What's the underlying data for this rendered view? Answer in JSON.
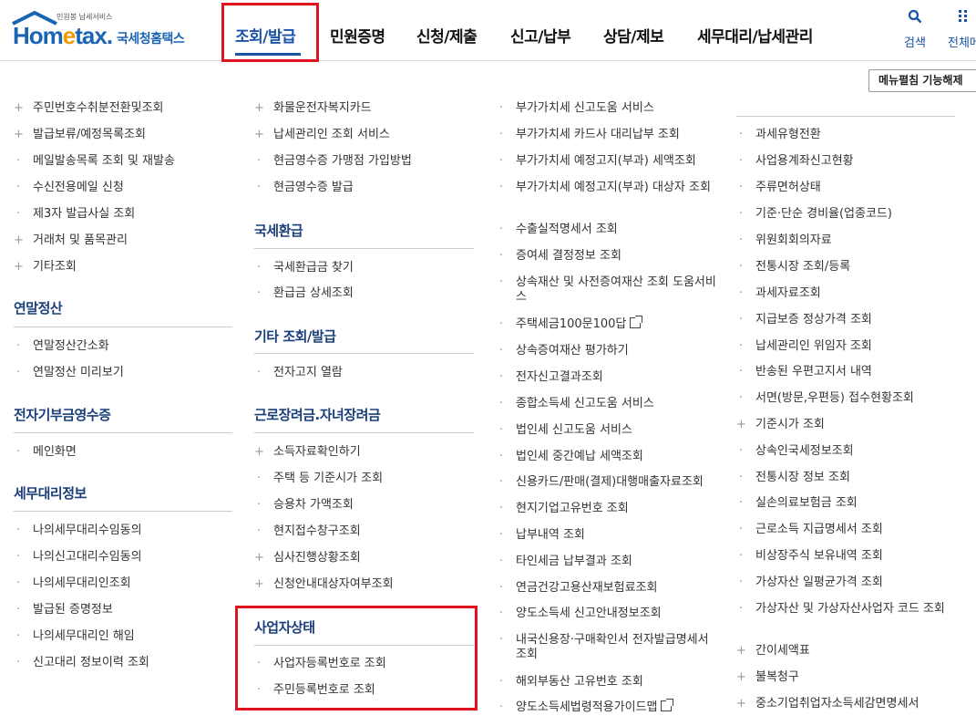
{
  "header": {
    "logo_sub": "민원봉 납세서비스",
    "logo_text_a": "Hom",
    "logo_text_b": "e",
    "logo_text_c": "tax.",
    "logo_kr": "국세청홈택스",
    "nav": [
      "조회/발급",
      "민원증명",
      "신청/제출",
      "신고/납부",
      "상담/제보",
      "세무대리/납세관리"
    ],
    "search_label": "검색",
    "menu_label": "전체메"
  },
  "fold_button": "메뉴펼침 기능해제",
  "col1": {
    "items_a": [
      {
        "m": "+",
        "t": "주민번호수취분전환및조회"
      },
      {
        "m": "+",
        "t": "발급보류/예정목록조회"
      },
      {
        "m": "·",
        "t": "메일발송목록 조회 및 재발송"
      },
      {
        "m": "·",
        "t": "수신전용메일 신청"
      },
      {
        "m": "·",
        "t": "제3자 발급사실 조회"
      },
      {
        "m": "+",
        "t": "거래처 및 품목관리"
      },
      {
        "m": "+",
        "t": "기타조회"
      }
    ],
    "sec1": "연말정산",
    "items_b": [
      {
        "m": "·",
        "t": "연말정산간소화"
      },
      {
        "m": "·",
        "t": "연말정산 미리보기"
      }
    ],
    "sec2": "전자기부금영수증",
    "items_c": [
      {
        "m": "·",
        "t": "메인화면"
      }
    ],
    "sec3": "세무대리정보",
    "items_d": [
      {
        "m": "·",
        "t": "나의세무대리수임동의"
      },
      {
        "m": "·",
        "t": "나의신고대리수임동의"
      },
      {
        "m": "·",
        "t": "나의세무대리인조회"
      },
      {
        "m": "·",
        "t": "발급된 증명정보"
      },
      {
        "m": "·",
        "t": "나의세무대리인 해임"
      },
      {
        "m": "·",
        "t": "신고대리 정보이력 조회"
      }
    ]
  },
  "col2": {
    "items_a": [
      {
        "m": "+",
        "t": "화물운전자복지카드"
      },
      {
        "m": "+",
        "t": "납세관리인 조회 서비스"
      },
      {
        "m": "·",
        "t": "현금영수증 가맹점 가입방법"
      },
      {
        "m": "·",
        "t": "현금영수증 발급"
      }
    ],
    "sec1": "국세환급",
    "items_b": [
      {
        "m": "·",
        "t": "국세환급금 찾기"
      },
      {
        "m": "·",
        "t": "환급금 상세조회"
      }
    ],
    "sec2": "기타 조회/발급",
    "items_c": [
      {
        "m": "·",
        "t": "전자고지 열람"
      }
    ],
    "sec3": "근로장려금.자녀장려금",
    "items_d": [
      {
        "m": "+",
        "t": "소득자료확인하기"
      },
      {
        "m": "·",
        "t": "주택 등 기준시가 조회"
      },
      {
        "m": "·",
        "t": "승용차 가액조회"
      },
      {
        "m": "·",
        "t": "현지접수창구조회"
      },
      {
        "m": "+",
        "t": "심사진행상황조회"
      },
      {
        "m": "+",
        "t": "신청안내대상자여부조회"
      }
    ],
    "sec4": "사업자상태",
    "items_e": [
      {
        "m": "·",
        "t": "사업자등록번호로 조회"
      },
      {
        "m": "·",
        "t": "주민등록번호로 조회"
      }
    ]
  },
  "col3": {
    "items": [
      {
        "m": "·",
        "t": "부가가치세 신고도움 서비스"
      },
      {
        "m": "·",
        "t": "부가가치세 카드사 대리납부 조회"
      },
      {
        "m": "·",
        "t": "부가가치세 예정고지(부과) 세액조회"
      },
      {
        "m": "·",
        "t": "부가가치세 예정고지(부과) 대상자 조회"
      },
      {
        "m": "·",
        "t": "수출실적명세서 조회"
      },
      {
        "m": "·",
        "t": "증여세 결정정보 조회"
      },
      {
        "m": "·",
        "t": "상속재산 및 사전증여재산 조회 도움서비스"
      },
      {
        "m": "·",
        "t": "주택세금100문100답"
      },
      {
        "m": "·",
        "t": "상속증여재산 평가하기"
      },
      {
        "m": "·",
        "t": "전자신고결과조회"
      },
      {
        "m": "·",
        "t": "종합소득세 신고도움 서비스"
      },
      {
        "m": "·",
        "t": "법인세 신고도움 서비스"
      },
      {
        "m": "·",
        "t": "법인세 중간예납 세액조회"
      },
      {
        "m": "·",
        "t": "신용카드/판매(결제)대행매출자료조회"
      },
      {
        "m": "·",
        "t": "현지기업고유번호 조회"
      },
      {
        "m": "·",
        "t": "납부내역 조회"
      },
      {
        "m": "·",
        "t": "타인세금 납부결과 조회"
      },
      {
        "m": "·",
        "t": "연금건강고용산재보험료조회"
      },
      {
        "m": "·",
        "t": "양도소득세 신고안내정보조회"
      },
      {
        "m": "·",
        "t": "내국신용장·구매확인서 전자발급명세서 조회"
      },
      {
        "m": "·",
        "t": "해외부동산 고유번호 조회"
      },
      {
        "m": "·",
        "t": "양도소득세법령적용가이드맵"
      }
    ]
  },
  "col4": {
    "items": [
      {
        "m": "·",
        "t": "과세유형전환"
      },
      {
        "m": "·",
        "t": "사업용계좌신고현황"
      },
      {
        "m": "·",
        "t": "주류면허상태"
      },
      {
        "m": "·",
        "t": "기준·단순 경비율(업종코드)"
      },
      {
        "m": "·",
        "t": "위원회회의자료"
      },
      {
        "m": "·",
        "t": "전통시장 조회/등록"
      },
      {
        "m": "·",
        "t": "과세자료조회"
      },
      {
        "m": "·",
        "t": "지급보증 정상가격 조회"
      },
      {
        "m": "·",
        "t": "납세관리인 위임자 조회"
      },
      {
        "m": "·",
        "t": "반송된 우편고지서 내역"
      },
      {
        "m": "·",
        "t": "서면(방문,우편등) 접수현황조회"
      },
      {
        "m": "+",
        "t": "기준시가 조회"
      },
      {
        "m": "·",
        "t": "상속인국세정보조회"
      },
      {
        "m": "·",
        "t": "전통시장 정보 조회"
      },
      {
        "m": "·",
        "t": "실손의료보험금 조회"
      },
      {
        "m": "·",
        "t": "근로소득 지급명세서 조회"
      },
      {
        "m": "·",
        "t": "비상장주식 보유내역 조회"
      },
      {
        "m": "·",
        "t": "가상자산 일평균가격 조회"
      },
      {
        "m": "·",
        "t": "가상자산 및 가상자산사업자 코드 조회"
      },
      {
        "m": "+",
        "t": "간이세액표"
      },
      {
        "m": "+",
        "t": "불복청구"
      },
      {
        "m": "+",
        "t": "중소기업취업자소득세감면명세서"
      }
    ]
  }
}
